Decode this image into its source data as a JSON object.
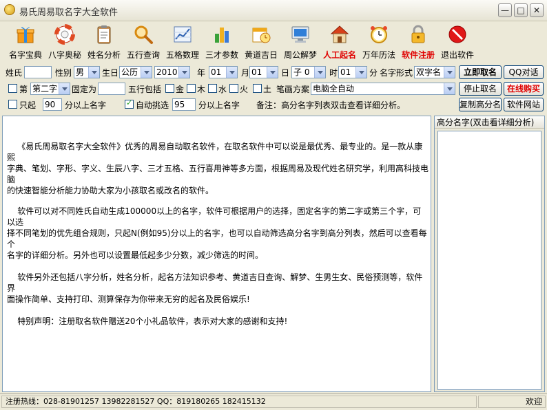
{
  "window": {
    "title": "易氏周易取名字大全软件",
    "min_label": "—",
    "max_label": "□",
    "close_label": "✕"
  },
  "toolbar": [
    {
      "label": "名字宝典",
      "icon": "gift-box-icon"
    },
    {
      "label": "八字奥秘",
      "icon": "lifebuoy-icon"
    },
    {
      "label": "姓名分析",
      "icon": "clipboard-icon"
    },
    {
      "label": "五行查询",
      "icon": "magnifier-icon"
    },
    {
      "label": "五格数理",
      "icon": "line-chart-icon"
    },
    {
      "label": "三才参数",
      "icon": "bar-chart-icon"
    },
    {
      "label": "黄道吉日",
      "icon": "calendar-clock-icon"
    },
    {
      "label": "周公解梦",
      "icon": "monitor-icon"
    },
    {
      "label": "人工起名",
      "icon": "house-icon",
      "highlight": true
    },
    {
      "label": "万年历法",
      "icon": "alarm-clock-icon"
    },
    {
      "label": "软件注册",
      "icon": "padlock-icon",
      "highlight": true
    },
    {
      "label": "退出软件",
      "icon": "stop-sign-icon"
    }
  ],
  "form": {
    "surname_label": "姓氏",
    "surname_value": "",
    "gender_label": "性别",
    "gender_value": "男",
    "birthday_label": "生日",
    "calendar_value": "公历",
    "year_value": "2010",
    "year_label": "年",
    "month_value": "01",
    "month_label": "月",
    "day_value": "01",
    "day_label": "日",
    "zi_value": "子",
    "zi_num_value": "0",
    "hour_value": "01",
    "hour_label": "时",
    "minute_value": "01",
    "minute_label": "分",
    "name_form_label": "名字形式",
    "name_form_value": "双字名",
    "position_label": "第",
    "position_value": "第二字",
    "fixed_label": "固定为",
    "fixed_value": "",
    "wuxing_label": "五行包括",
    "wuxing": [
      "金",
      "木",
      "水",
      "火",
      "土"
    ],
    "stroke_label": "笔画方案",
    "stroke_value": "电脑全自动",
    "only_from_label": "只起",
    "score_min_value": "90",
    "score_min_suffix": "分以上名字",
    "auto_pick_label": "自动挑选",
    "auto_pick_value": "95",
    "auto_pick_suffix": "分以上名字",
    "note": "备注：高分名字列表双击查看详细分析。"
  },
  "buttons": {
    "generate": "立即取名",
    "qq": "QQ对话",
    "stop": "停止取名",
    "buy": "在线购买",
    "copy": "复制高分名",
    "website": "软件网站"
  },
  "main_text": {
    "p1": "    《易氏周易取名字大全软件》优秀的周易自动取名软件，在取名软件中可以说是最优秀、最专业的。是一款从康熙\n字典、笔划、字形、字义、生辰八字、三才五格、五行喜用神等多方面，根据周易及现代姓名研究学，利用高科技电脑\n的快速智能分析能力协助大家为小孩取名或改名的软件。",
    "p2": "    软件可以对不同姓氏自动生成100000以上的名字，软件可根据用户的选择，固定名字的第二字或第三个字，可以选\n择不同笔划的优先组合规则，只起N(例如95)分以上的名字，也可以自动筛选高分名字到高分列表，然后可以查看每个\n名字的详细分析。另外也可以设置最低起多少分数，减少筛选的时间。",
    "p3": "    软件另外还包括八字分析，姓名分析，起名方法知识参考、黄道吉日查询、解梦、生男生女、民俗预测等，软件界\n面操作简单、支持打印、测算保存为你带来无穷的起名及民俗娱乐!",
    "p4": "    特别声明：注册取名软件赠送20个小礼品软件，表示对大家的感谢和支持!"
  },
  "side_panel": {
    "header": "高分名字(双击看详细分析)"
  },
  "status": {
    "left": "注册热线：028-81901257 13982281527 QQ：819180265 182415132",
    "right": "欢迎"
  },
  "colors": {
    "highlight_red": "#e00000",
    "window_bg": "#ece9d8",
    "border_blue": "#7f9db9"
  }
}
